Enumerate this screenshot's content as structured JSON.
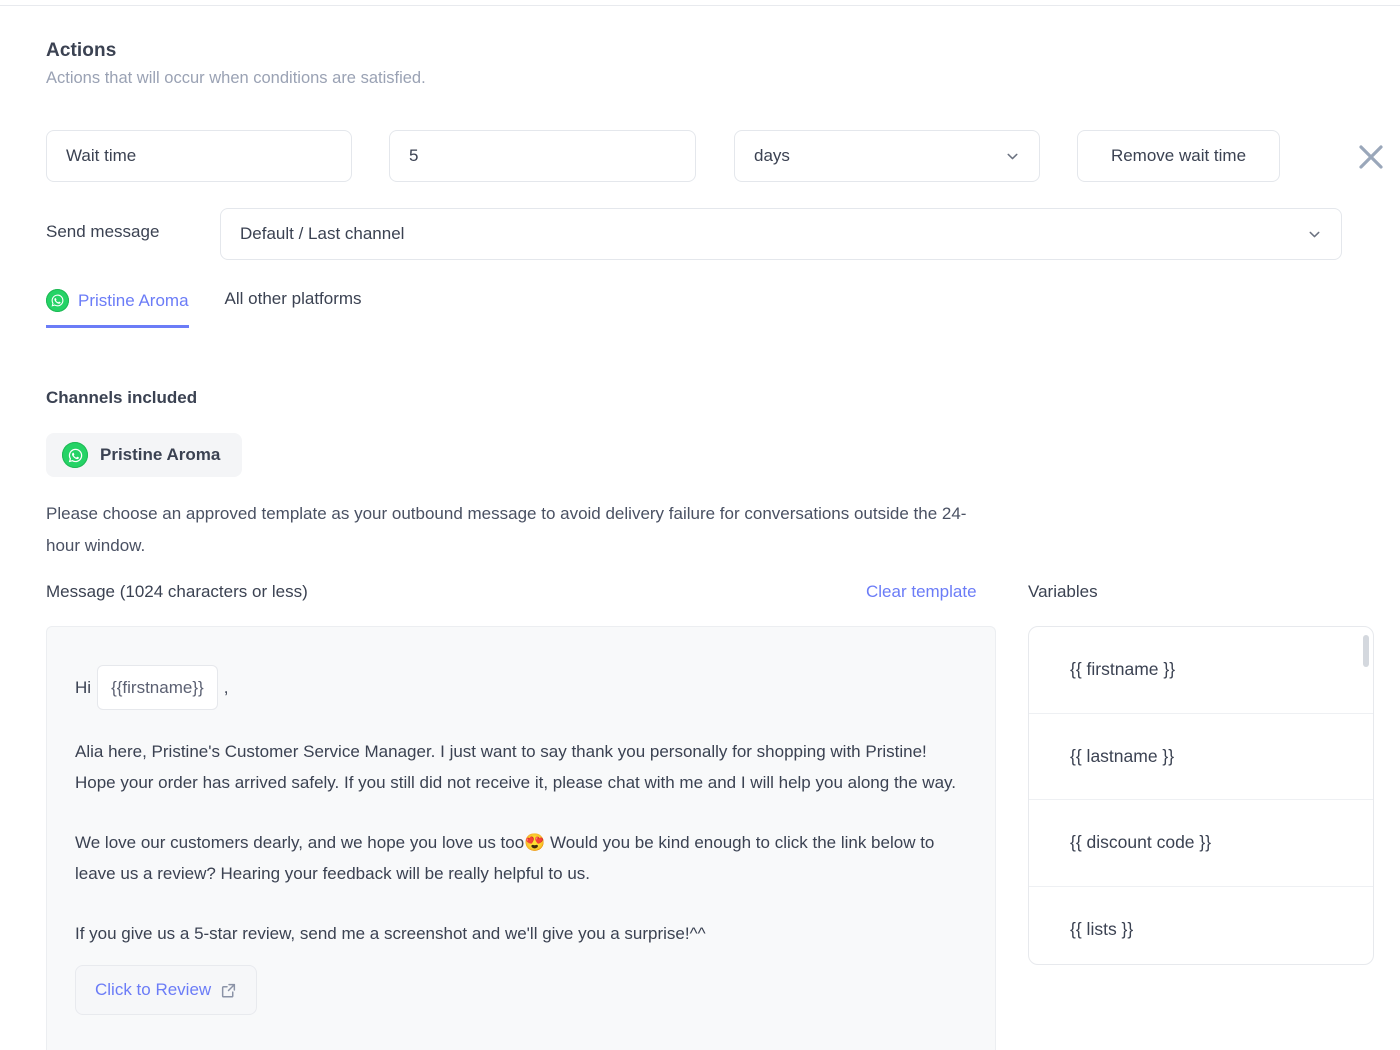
{
  "section": {
    "title": "Actions",
    "subtitle": "Actions that will occur when conditions are satisfied."
  },
  "wait_time": {
    "label": "Wait time",
    "value": "5",
    "unit": "days",
    "remove_label": "Remove wait time",
    "close_icon": "close-icon",
    "chevron_icon": "chevron-down-icon"
  },
  "send_message": {
    "label": "Send message",
    "selected_channel": "Default / Last channel",
    "chevron_icon": "chevron-down-icon"
  },
  "tabs": [
    {
      "label": "Pristine Aroma",
      "icon": "whatsapp-icon",
      "active": true
    },
    {
      "label": "All other platforms",
      "icon": "",
      "active": false
    }
  ],
  "channels": {
    "title": "Channels included",
    "chip_label": "Pristine Aroma",
    "chip_icon": "whatsapp-icon"
  },
  "notice": "Please choose an approved template as your outbound message to avoid delivery failure for conversations outside the 24-hour window.",
  "message_header": {
    "label": "Message (1024 characters or less)",
    "clear_template": "Clear template",
    "variables": "Variables"
  },
  "message_body": {
    "greeting_prefix": "Hi",
    "greeting_variable": "{{firstname}}",
    "greeting_suffix": ",",
    "paragraph_1": "Alia here, Pristine's Customer Service Manager. I just want to say thank you personally for shopping with Pristine! Hope your order has arrived safely. If you still did not receive it, please chat with me and I will help you along the way.",
    "paragraph_2": "We love our customers dearly, and we hope you love us too😍 Would you be kind enough to click the link below to leave us a review? Hearing your feedback will be really helpful to us.",
    "paragraph_3": "If you give us a 5-star review, send me a screenshot and we'll give you a surprise!^^",
    "cta_label": "Click to Review",
    "cta_icon": "external-link-icon"
  },
  "variables_panel": {
    "items": [
      {
        "label": "{{ firstname }}"
      },
      {
        "label": "{{ lastname }}"
      },
      {
        "label": "{{ discount code }}"
      },
      {
        "label": "{{ lists }}"
      }
    ]
  },
  "colors": {
    "accent": "#6b7cf7",
    "whatsapp_green": "#25d366",
    "text": "#3b4252",
    "muted": "#9aa2b4",
    "border": "#e4e7ec"
  }
}
